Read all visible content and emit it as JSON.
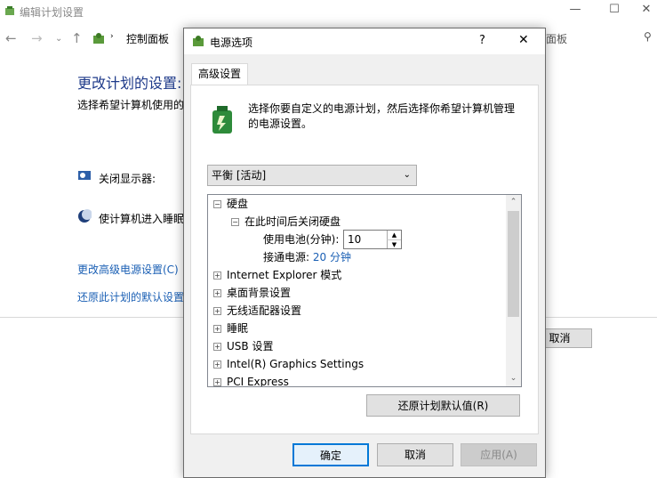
{
  "background": {
    "title": "编辑计划设置",
    "address": {
      "crumb": "控制面板",
      "search_partial": "面板"
    },
    "heading": "更改计划的设置:",
    "subtext": "选择希望计算机使用的",
    "display_label": "关闭显示器:",
    "sleep_label": "使计算机进入睡眠",
    "advanced_link": "更改高级电源设置(C)",
    "restore_link": "还原此计划的默认设置",
    "cancel": "取消"
  },
  "dialog": {
    "title": "电源选项",
    "help": "?",
    "close": "✕",
    "tab": "高级设置",
    "intro_line1": "选择你要自定义的电源计划，然后选择你希望计算机管理",
    "intro_line2": "的电源设置。",
    "plan_selected": "平衡 [活动]",
    "tree": {
      "hard_disk": "硬盘",
      "turn_off_after": "在此时间后关闭硬盘",
      "battery_label": "使用电池(分钟):",
      "battery_value": "10",
      "plugged_label": "接通电源:",
      "plugged_value": "20 分钟",
      "items": [
        "Internet Explorer 模式",
        "桌面背景设置",
        "无线适配器设置",
        "睡眠",
        "USB 设置",
        "Intel(R) Graphics Settings",
        "PCI Express"
      ]
    },
    "restore_defaults": "还原计划默认值(R)",
    "ok": "确定",
    "cancel": "取消",
    "apply": "应用(A)"
  }
}
